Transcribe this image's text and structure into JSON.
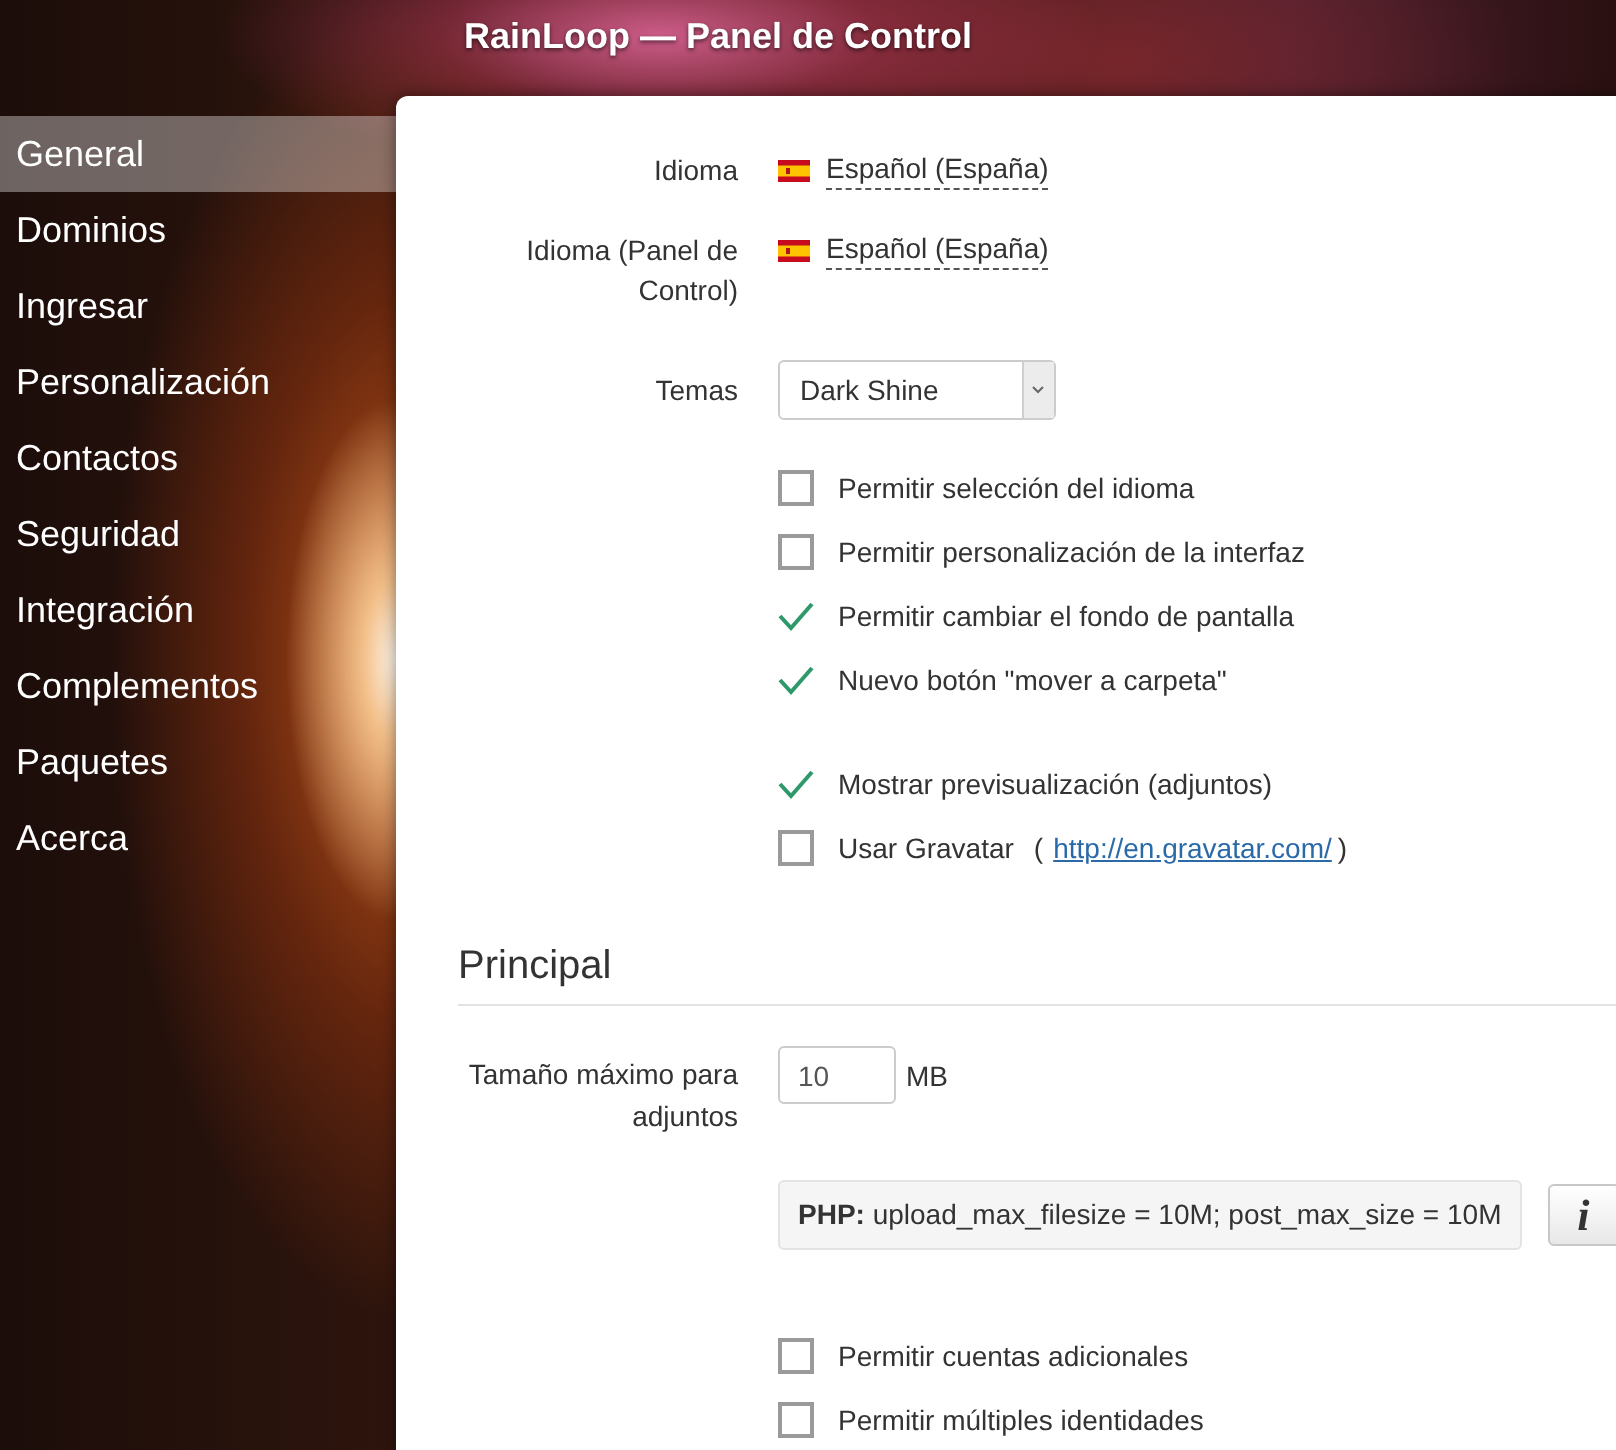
{
  "window": {
    "title": "RainLoop — Panel de Control"
  },
  "sidebar": {
    "items": [
      {
        "label": "General",
        "selected": true
      },
      {
        "label": "Dominios",
        "selected": false
      },
      {
        "label": "Ingresar",
        "selected": false
      },
      {
        "label": "Personalización",
        "selected": false
      },
      {
        "label": "Contactos",
        "selected": false
      },
      {
        "label": "Seguridad",
        "selected": false
      },
      {
        "label": "Integración",
        "selected": false
      },
      {
        "label": "Complementos",
        "selected": false
      },
      {
        "label": "Paquetes",
        "selected": false
      },
      {
        "label": "Acerca",
        "selected": false
      }
    ]
  },
  "general": {
    "fields": [
      {
        "kind": "language",
        "label": "Idioma",
        "value": "Español (España)"
      },
      {
        "kind": "language",
        "label": "Idioma (Panel de Control)",
        "value": "Español (España)"
      },
      {
        "kind": "select",
        "label": "Temas",
        "value": "Dark Shine"
      }
    ],
    "option_groups": [
      [
        {
          "label": "Permitir selección del idioma",
          "checked": false
        },
        {
          "label": "Permitir personalización de la interfaz",
          "checked": false
        },
        {
          "label": "Permitir cambiar el fondo de pantalla",
          "checked": true
        },
        {
          "label": "Nuevo botón \"mover a carpeta\"",
          "checked": true
        }
      ],
      [
        {
          "label": "Mostrar previsualización (adjuntos)",
          "checked": true
        },
        {
          "label": "Usar Gravatar",
          "checked": false,
          "link_prefix": "(",
          "link": "http://en.gravatar.com/",
          "link_suffix": ")"
        }
      ]
    ]
  },
  "principal": {
    "heading": "Principal",
    "attachment_limit": {
      "label": "Tamaño máximo para adjuntos",
      "value": "10",
      "unit": "MB"
    },
    "php_note": "**PHP:** upload_max_filesize = 10M; post_max_size = 10M",
    "info_button": "i",
    "options": [
      {
        "label": "Permitir cuentas adicionales",
        "checked": false
      },
      {
        "label": "Permitir múltiples identidades",
        "checked": false
      }
    ]
  }
}
